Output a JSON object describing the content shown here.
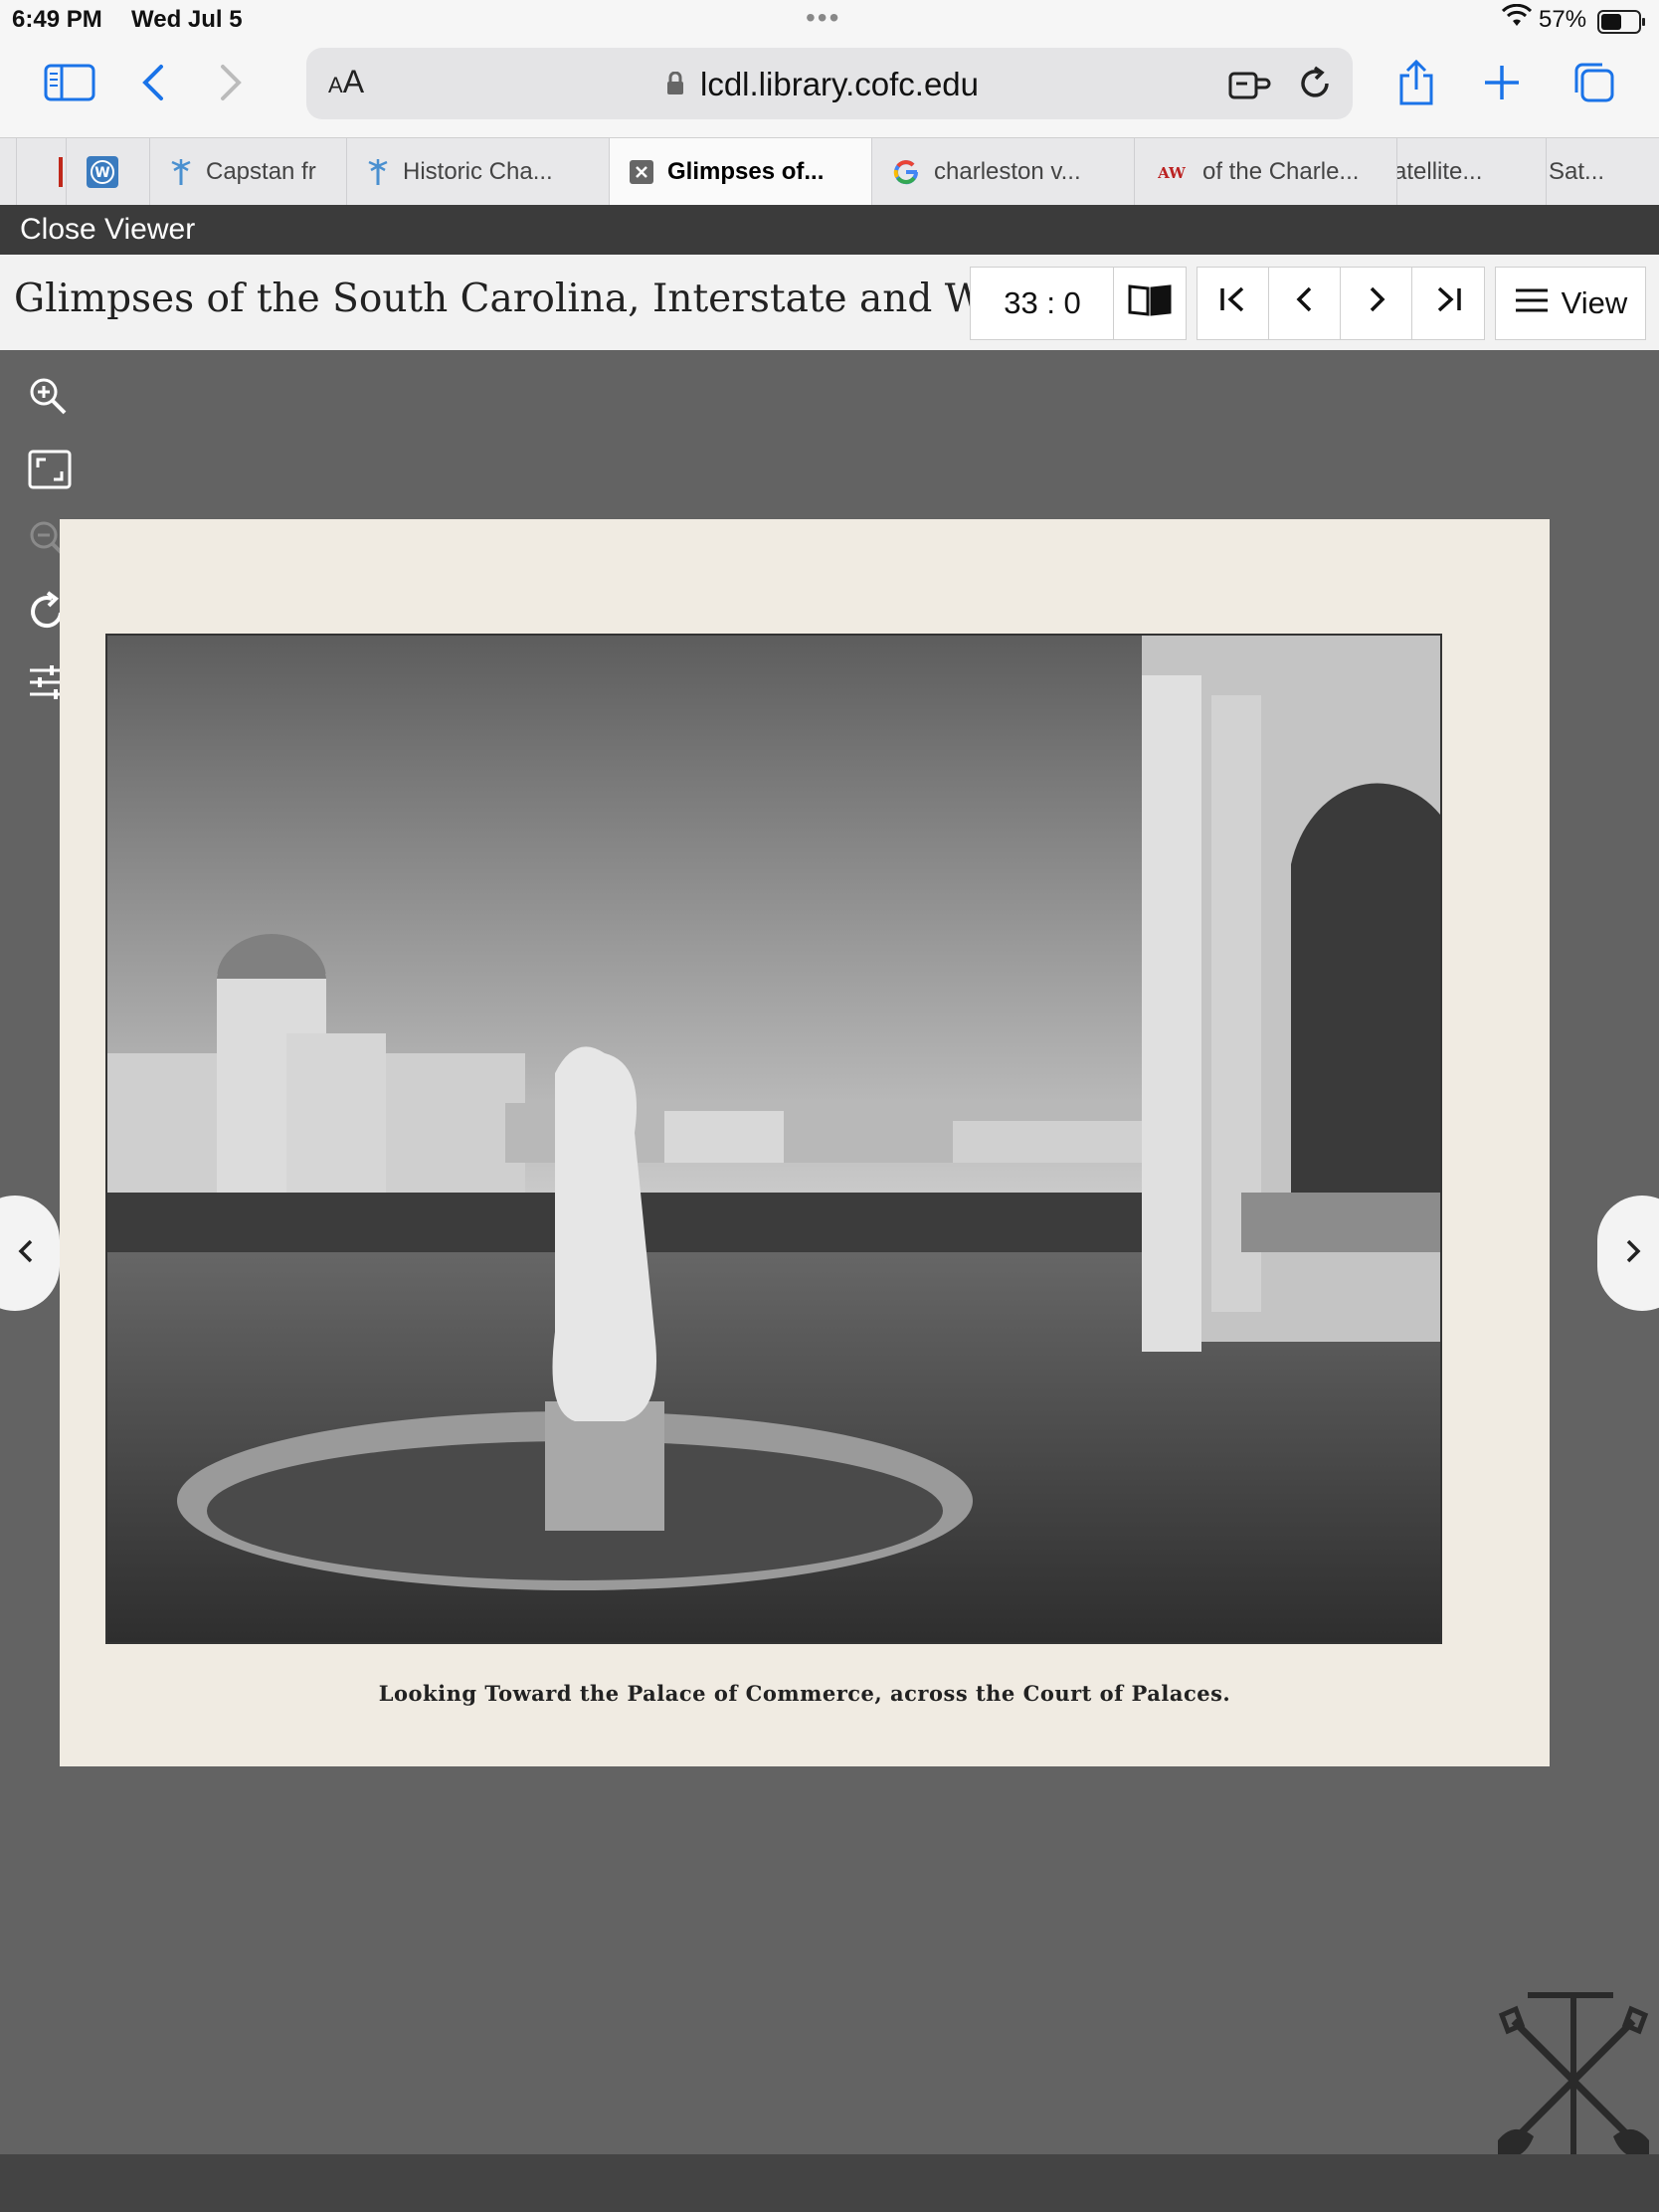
{
  "status": {
    "time": "6:49 PM",
    "date": "Wed Jul 5",
    "battery": "57%"
  },
  "browser": {
    "aa_label": "AA",
    "url": "lcdl.library.cofc.edu",
    "tabs": [
      {
        "label": "Capstan fr"
      },
      {
        "label": "Historic Cha..."
      },
      {
        "label": "Glimpses of..."
      },
      {
        "label": "charleston v..."
      },
      {
        "label": "of the Charle..."
      },
      {
        "label": "atellite..."
      },
      {
        "label": "Sat..."
      }
    ]
  },
  "viewer": {
    "close_label": "Close Viewer",
    "title": "Glimpses of the South Carolina, Interstate and Wes...",
    "page_counter": "33 : 0",
    "view_label": "View",
    "caption": "Looking Toward the Palace of Commerce, across the Court of Palaces."
  },
  "colors": {
    "accent": "#1a73e8",
    "viewer_bg": "#636363",
    "page_bg": "#f0ebe2"
  }
}
